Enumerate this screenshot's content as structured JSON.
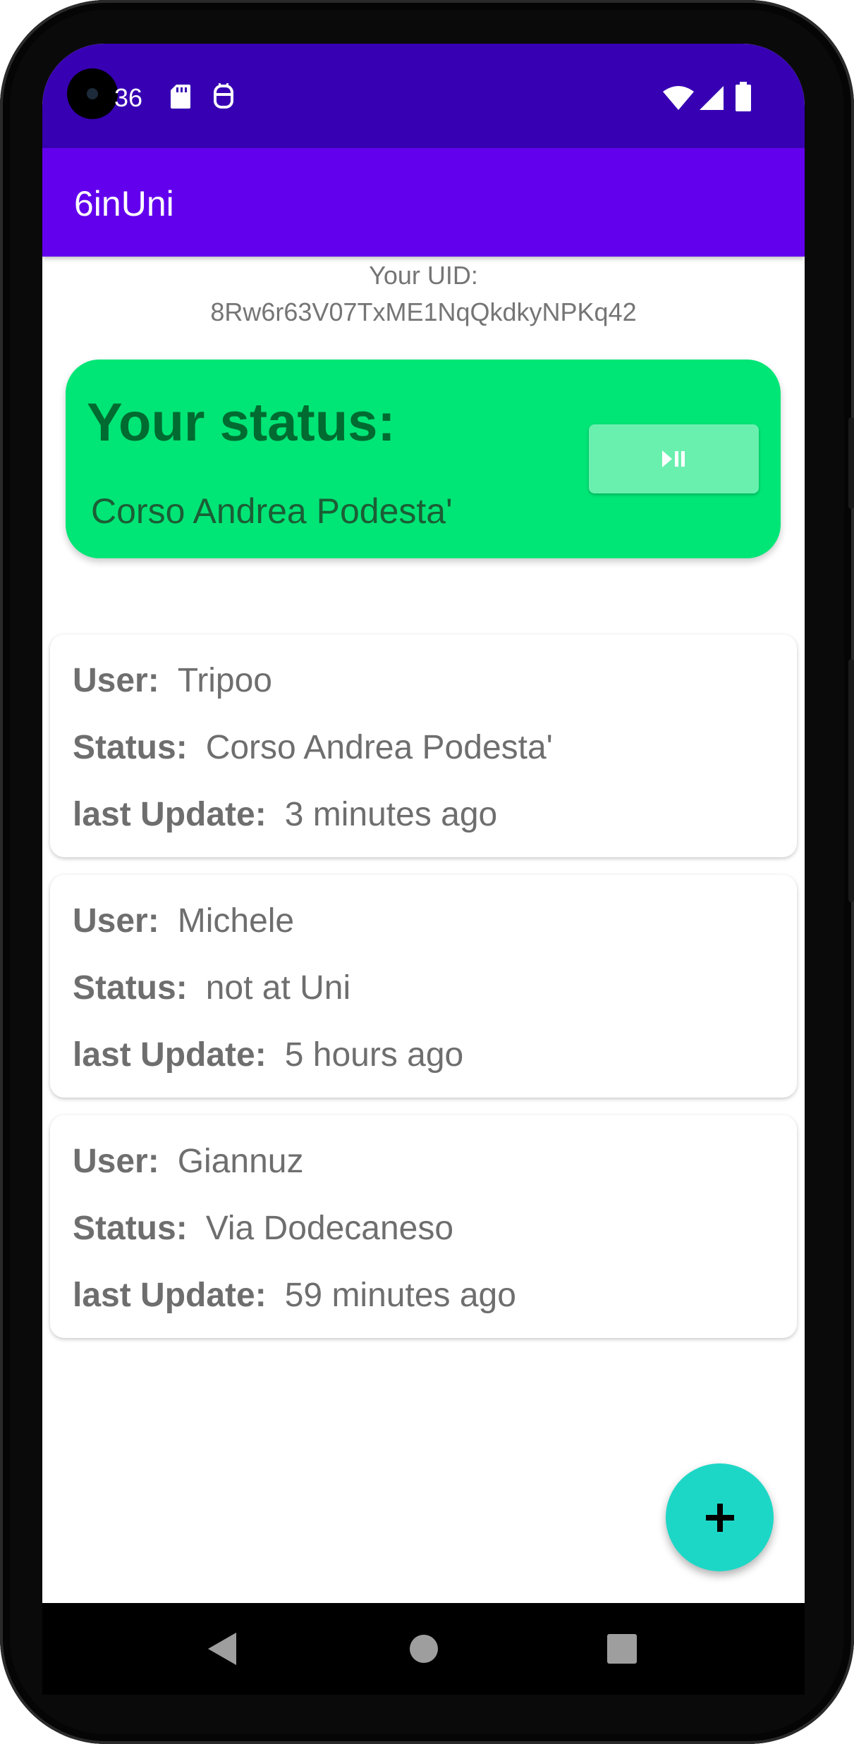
{
  "status_bar": {
    "time": "36",
    "icons": [
      "sd-card-icon",
      "android-debug-icon",
      "wifi-icon",
      "signal-icon",
      "battery-icon"
    ]
  },
  "app_bar": {
    "title": "6inUni"
  },
  "uid": {
    "label": "Your UID:",
    "value": "8Rw6r63V07TxME1NqQkdkyNPKq42"
  },
  "my_status": {
    "heading": "Your status:",
    "current": "Corso Andrea Podesta'",
    "toggle_icon": "play-pause-icon"
  },
  "labels": {
    "user": "User:",
    "status": "Status:",
    "last_update": "last Update:"
  },
  "users": [
    {
      "user": "Tripoo",
      "status": "Corso Andrea Podesta'",
      "last_update": "3 minutes ago"
    },
    {
      "user": "Michele",
      "status": "not at Uni",
      "last_update": "5 hours ago"
    },
    {
      "user": "Giannuz",
      "status": "Via Dodecaneso",
      "last_update": "59 minutes ago"
    }
  ],
  "fab": {
    "icon": "plus-icon"
  },
  "nav": {
    "icons": [
      "back-icon",
      "home-icon",
      "recents-icon"
    ]
  },
  "colors": {
    "status_bar": "#3700b3",
    "app_bar": "#6200ee",
    "status_card": "#00e676",
    "fab": "#1dd7c6"
  }
}
